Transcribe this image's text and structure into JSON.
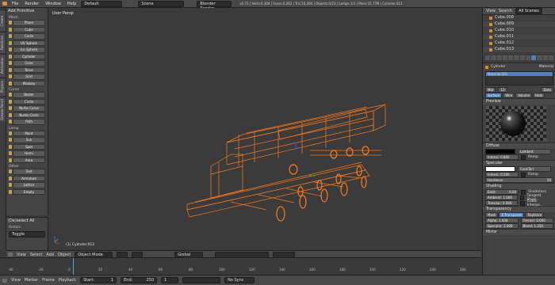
{
  "topbar": {
    "menus": [
      "File",
      "Render",
      "Window",
      "Help"
    ],
    "layout": "Default",
    "scene": "Scene",
    "engine": "Blender Render",
    "stats": "v2.73 | Verts:0.304 | Faces:0.263 | Tris:16,294 | Objects:0/23 | Lamps:1/1 | Mem:25.77M | Cylinder.013"
  },
  "left_tabs": [
    "Create",
    "Relations",
    "Animation",
    "Physics",
    "Grease Pencil"
  ],
  "tools": {
    "header": "Add Primitive",
    "groups": [
      {
        "title": "Mesh",
        "items": [
          "Plane",
          "Cube",
          "Circle",
          "UV Sphere",
          "Ico Sphere",
          "Cylinder",
          "Cone",
          "Torus",
          "Grid",
          "Monkey"
        ]
      },
      {
        "title": "Curve",
        "items": [
          "Bezier",
          "Circle",
          "Nurbs Curve",
          "Nurbs Circle",
          "Path"
        ]
      },
      {
        "title": "Lamp",
        "items": [
          "Point",
          "Sun",
          "Spot",
          "Hemi",
          "Area"
        ]
      },
      {
        "title": "Other",
        "items": [
          "Text",
          "Armature",
          "Lattice",
          "Empty"
        ]
      }
    ]
  },
  "operator": {
    "title": "(De)select All",
    "label": "Action:",
    "value": "Toggle"
  },
  "viewport": {
    "title": "User Persp",
    "selected": "(1) Cylinder.013"
  },
  "header": {
    "items": [
      "View",
      "Select",
      "Add",
      "Object"
    ],
    "mode": "Object Mode",
    "pivot": "Global"
  },
  "footer": {
    "items": [
      "View",
      "Marker",
      "Frame",
      "Playback"
    ],
    "start": "Start:",
    "start_val": "1",
    "end": "End:",
    "end_val": "250",
    "current": "1",
    "sync": "No Sync"
  },
  "timeline_ticks": [
    "-40",
    "-20",
    "0",
    "20",
    "40",
    "60",
    "80",
    "100",
    "120",
    "140",
    "160",
    "180",
    "200",
    "220",
    "240",
    "260"
  ],
  "outliner": {
    "tabs": [
      "View",
      "Search",
      "All Scenes"
    ],
    "rows": [
      "Cube.008",
      "Cube.009",
      "Cube.010",
      "Cube.011",
      "Cube.012",
      "Cube.013"
    ]
  },
  "props": {
    "object": "Cylinder",
    "context": "Material",
    "material_slot": "Material.001",
    "mat_name": "Mat",
    "mat_users": "13",
    "data": "Data",
    "mat_tabs": [
      "Surface",
      "Wire",
      "Volume",
      "Halo"
    ],
    "preview": "Preview",
    "diffuse": {
      "title": "Diffuse",
      "shader": "Lambert",
      "intensity": "Intensi: 0.800",
      "ramp": "Ramp"
    },
    "specular": {
      "title": "Specular",
      "shader": "CookTorr",
      "intensity": "Intensi: 0.500",
      "ramp": "Ramp",
      "hardness": "Hardness:",
      "hardness_val": "50"
    },
    "shading": {
      "title": "Shading",
      "emit": "Emit:",
      "emit_val": "0.00",
      "ambient": "Ambient: 1.000",
      "translucency": "Transluc: 0.000",
      "shadeless": "Shadeless",
      "tangent": "Tangent Shad...",
      "cubic": "Cubic Interpo..."
    },
    "transparency": {
      "title": "Transparency",
      "modes": [
        "Mask",
        "Z Transparen",
        "Raytrace"
      ],
      "alpha": "Alpha: 1.000",
      "specular": "Specular: 1.000",
      "fresnel": "Fresnel: 0.000",
      "blend": "Blend: 1.250"
    },
    "mirror": "Mirror"
  },
  "colors": {
    "wire": "#ff7a1a",
    "active_blue": "#4f7fbd",
    "selection": "#e08a2a"
  }
}
